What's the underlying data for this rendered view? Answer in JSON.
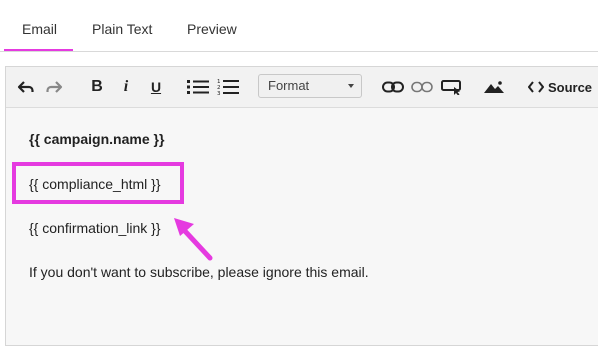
{
  "tabs": [
    {
      "label": "Email"
    },
    {
      "label": "Plain Text"
    },
    {
      "label": "Preview"
    }
  ],
  "toolbar": {
    "format_label": "Format",
    "source_label": "Source",
    "icons": [
      "undo-icon",
      "redo-icon",
      "bold-icon",
      "italic-icon",
      "underline-icon",
      "bullet-list-icon",
      "numbered-list-icon",
      "link-icon",
      "unlink-icon",
      "insert-button-icon",
      "image-icon",
      "source-code-icon"
    ]
  },
  "content": {
    "line1": "{{ campaign.name }}",
    "line2": "{{ compliance_html }}",
    "line3": "{{ confirmation_link }}",
    "line4": "If you don't want to subscribe, please ignore this email."
  },
  "annotation": {
    "highlight_color": "#e53ae0",
    "arrow_color": "#e53ae0"
  }
}
